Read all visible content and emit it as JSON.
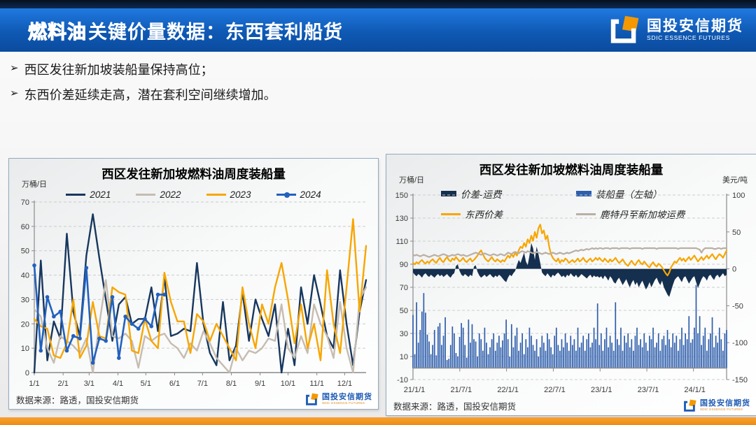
{
  "header": {
    "title_emphasis": "燃料油",
    "title_rest": "关键价量数据：东西套利船货",
    "logo_cn": "国投安信期货",
    "logo_en": "SDIC ESSENCE FUTURES"
  },
  "bullets": [
    "西区发往新加坡装船量保持高位；",
    "东西价差延续走高，潜在套利空间继续增加。"
  ],
  "source_note": "数据来源：路透，国投安信期货",
  "colors": {
    "header_blue": "#0f59b4",
    "accent_orange": "#f39800",
    "bottom_bar_orange": "#ee8c12",
    "navy_2021": "#17375e",
    "gray_2022": "#c6bcb0",
    "orange_2023": "#f7a600",
    "blue_2024": "#2261be",
    "bar_blue": "#2e5eac",
    "area_navy": "#152f4e",
    "freight_gray": "#b9afa4"
  },
  "chart_data": [
    {
      "type": "line",
      "title": "西区发往新加坡燃料油周度装船量",
      "ylabel": "万桶/日",
      "ylim": [
        0,
        70
      ],
      "yticks": [
        0,
        10,
        20,
        30,
        40,
        50,
        60,
        70
      ],
      "grid": "dashed-horizontal",
      "legend_position": "top-inside",
      "xmax": 51,
      "xticks": [
        {
          "p": 0,
          "label": "1/1"
        },
        {
          "p": 4.43,
          "label": "2/1"
        },
        {
          "p": 8.43,
          "label": "3/1"
        },
        {
          "p": 12.86,
          "label": "4/1"
        },
        {
          "p": 17.14,
          "label": "5/1"
        },
        {
          "p": 21.57,
          "label": "6/1"
        },
        {
          "p": 25.86,
          "label": "7/1"
        },
        {
          "p": 30.29,
          "label": "8/1"
        },
        {
          "p": 34.71,
          "label": "9/1"
        },
        {
          "p": 39.0,
          "label": "10/1"
        },
        {
          "p": 43.43,
          "label": "11/1"
        },
        {
          "p": 47.71,
          "label": "12/1"
        }
      ],
      "series": [
        {
          "name": "2021",
          "color": "#17375e",
          "width": 2.4,
          "marker": false,
          "values": [
            0,
            46,
            5,
            21,
            14,
            57,
            25,
            15,
            48,
            65,
            47,
            30,
            13,
            28,
            31,
            20,
            22,
            22,
            35,
            17,
            39,
            15,
            16,
            18,
            17,
            45,
            20,
            8,
            3,
            29,
            5,
            11,
            33,
            13,
            30,
            22,
            15,
            28,
            0,
            18,
            3,
            35,
            20,
            40,
            28,
            15,
            10,
            42,
            20,
            3,
            25,
            38
          ]
        },
        {
          "name": "2022",
          "color": "#c6bcb0",
          "width": 2.4,
          "marker": false,
          "values": [
            26,
            23,
            10,
            4,
            15,
            13,
            11,
            8,
            14,
            0,
            20,
            38,
            15,
            14,
            16,
            13,
            2,
            15,
            13,
            15,
            16,
            12,
            10,
            6,
            12,
            9,
            17,
            12,
            6,
            3,
            0,
            10,
            5,
            9,
            8,
            10,
            14,
            13,
            28,
            10,
            6,
            15,
            8,
            28,
            20,
            15,
            6,
            29,
            10,
            0,
            30,
            35
          ]
        },
        {
          "name": "2023",
          "color": "#f7a600",
          "width": 2.4,
          "marker": false,
          "values": [
            22,
            19,
            18,
            7,
            6,
            12,
            30,
            6,
            11,
            29,
            15,
            14,
            35,
            33,
            32,
            9,
            8,
            22,
            13,
            10,
            41,
            29,
            21,
            21,
            8,
            24,
            21,
            13,
            20,
            15,
            10,
            5,
            35,
            20,
            10,
            28,
            20,
            35,
            45,
            30,
            12,
            28,
            10,
            20,
            5,
            42,
            20,
            8,
            35,
            63,
            25,
            52
          ]
        },
        {
          "name": "2024",
          "color": "#2261be",
          "width": 2.6,
          "marker": true,
          "values": [
            44,
            9,
            31,
            23,
            25,
            9,
            15,
            14,
            43,
            4,
            14,
            13,
            31,
            6,
            23,
            20,
            18,
            22,
            19,
            32,
            32
          ]
        }
      ]
    },
    {
      "type": "combo",
      "title": "西区发往新加坡燃料油周度装船量",
      "ylabel_left": "万桶/日",
      "ylabel_right": "美元/吨",
      "ylim_left": [
        -10,
        150
      ],
      "yticks_left": [
        -10,
        10,
        30,
        50,
        70,
        90,
        110,
        130,
        150
      ],
      "ylim_right": [
        -150,
        100
      ],
      "yticks_right": [
        -150,
        -100,
        -50,
        0,
        50,
        100
      ],
      "grid": "dashed-horizontal",
      "xmax": 175,
      "xticks": [
        {
          "p": 0,
          "label": "21/1/1"
        },
        {
          "p": 26.1,
          "label": "21/7/1"
        },
        {
          "p": 52.2,
          "label": "22/1/1"
        },
        {
          "p": 78.3,
          "label": "22/7/1"
        },
        {
          "p": 104.4,
          "label": "23/1/1"
        },
        {
          "p": 130.5,
          "label": "23/7/1"
        },
        {
          "p": 156.5,
          "label": "24/1/1"
        }
      ],
      "series": [
        {
          "name": "价差-运费",
          "kind": "area",
          "axis": "right",
          "color": "#152f4e",
          "values": [
            -5,
            -8,
            -10,
            -7,
            -9,
            -12,
            -8,
            -6,
            -9,
            -11,
            -8,
            -10,
            -12,
            -9,
            -7,
            -10,
            -8,
            -11,
            -9,
            -7,
            -10,
            -12,
            -8,
            -6,
            4,
            6,
            -3,
            -8,
            -10,
            -7,
            -9,
            -11,
            -8,
            -10,
            3,
            5,
            -4,
            -9,
            -12,
            -10,
            -8,
            -11,
            -9,
            -7,
            -10,
            -12,
            -9,
            -11,
            -8,
            -10,
            -13,
            -16,
            -18,
            -12,
            -8,
            -10,
            -6,
            -3,
            5,
            12,
            8,
            15,
            22,
            10,
            5,
            18,
            35,
            28,
            12,
            30,
            20,
            8,
            -5,
            -8,
            -10,
            -6,
            -9,
            -12,
            -8,
            -10,
            -7,
            -5,
            -8,
            -11,
            -9,
            -12,
            -8,
            -10,
            -6,
            -9,
            -11,
            -8,
            -12,
            -10,
            -7,
            -9,
            -11,
            -13,
            -10,
            -8,
            -12,
            -9,
            -11,
            -10,
            -12,
            -10,
            -14,
            -9,
            -12,
            -16,
            -10,
            -13,
            -18,
            -20,
            -15,
            -12,
            -17,
            -22,
            -18,
            -14,
            -20,
            -25,
            -19,
            -15,
            -22,
            -18,
            -25,
            -20,
            -16,
            -22,
            -28,
            -24,
            -18,
            -25,
            -20,
            -15,
            -12,
            -18,
            -22,
            -16,
            -25,
            -30,
            -35,
            -38,
            -30,
            -22,
            -15,
            -12,
            -10,
            -14,
            -18,
            -12,
            -10,
            -15,
            -20,
            -16,
            -12,
            -10,
            -18,
            -26,
            -20,
            -14,
            -10,
            -12,
            -16,
            -10,
            -8,
            -12,
            -15,
            -10,
            -8,
            -12,
            -9,
            -6,
            -10,
            -8
          ]
        },
        {
          "name": "装船量（左轴）",
          "kind": "bar",
          "axis": "left",
          "color": "#2e5eac",
          "values": [
            46,
            12,
            57,
            22,
            33,
            49,
            65,
            48,
            29,
            23,
            12,
            20,
            33,
            11,
            36,
            39,
            20,
            28,
            44,
            7,
            8,
            20,
            36,
            30,
            13,
            10,
            27,
            39,
            35,
            20,
            9,
            42,
            22,
            38,
            25,
            23,
            10,
            30,
            25,
            15,
            35,
            22,
            12,
            18,
            25,
            30,
            15,
            22,
            28,
            18,
            24,
            30,
            42,
            25,
            10,
            38,
            18,
            28,
            35,
            15,
            22,
            30,
            12,
            25,
            18,
            35,
            28,
            20,
            15,
            25,
            10,
            18,
            28,
            22,
            15,
            30,
            25,
            18,
            12,
            28,
            35,
            20,
            15,
            25,
            18,
            30,
            22,
            15,
            28,
            20,
            25,
            15,
            35,
            18,
            22,
            28,
            15,
            25,
            30,
            18,
            22,
            35,
            25,
            56,
            20,
            30,
            15,
            25,
            35,
            18,
            28,
            22,
            15,
            57,
            25,
            20,
            35,
            15,
            28,
            22,
            30,
            18,
            25,
            15,
            28,
            35,
            20,
            25,
            18,
            30,
            22,
            15,
            28,
            25,
            35,
            18,
            22,
            30,
            15,
            25,
            28,
            20,
            33,
            25,
            18,
            30,
            22,
            28,
            15,
            25,
            35,
            20,
            30,
            25,
            45,
            22,
            25,
            35,
            72,
            30,
            45,
            20,
            28,
            35,
            15,
            25,
            30,
            44,
            18,
            28,
            22,
            35,
            25,
            15,
            30,
            33
          ]
        },
        {
          "name": "东西价差",
          "kind": "line",
          "axis": "right",
          "color": "#f7a600",
          "width": 2.2,
          "values": [
            8,
            6,
            9,
            7,
            10,
            12,
            9,
            7,
            10,
            8,
            11,
            13,
            10,
            8,
            12,
            15,
            11,
            9,
            13,
            16,
            12,
            10,
            14,
            12,
            16,
            13,
            10,
            12,
            15,
            11,
            9,
            12,
            14,
            10,
            12,
            15,
            18,
            22,
            25,
            20,
            15,
            12,
            10,
            13,
            16,
            12,
            10,
            13,
            11,
            9,
            12,
            10,
            14,
            18,
            15,
            20,
            16,
            22,
            18,
            25,
            30,
            28,
            35,
            30,
            40,
            35,
            45,
            38,
            50,
            42,
            55,
            60,
            48,
            52,
            40,
            45,
            30,
            20,
            15,
            12,
            10,
            14,
            8,
            12,
            10,
            14,
            12,
            8,
            10,
            12,
            9,
            11,
            14,
            10,
            12,
            15,
            11,
            9,
            12,
            14,
            10,
            12,
            15,
            12,
            15,
            12,
            10,
            14,
            11,
            9,
            13,
            10,
            12,
            15,
            11,
            8,
            10,
            13,
            9,
            6,
            4,
            8,
            11,
            7,
            5,
            9,
            12,
            8,
            6,
            10,
            7,
            4,
            2,
            6,
            9,
            5,
            3,
            7,
            5,
            2,
            -2,
            -6,
            -9,
            -5,
            2,
            6,
            10,
            8,
            12,
            15,
            11,
            14,
            10,
            13,
            16,
            12,
            15,
            18,
            14,
            10,
            13,
            16,
            12,
            15,
            18,
            14,
            17,
            20,
            16,
            13,
            17,
            20,
            18,
            15,
            20,
            25
          ]
        },
        {
          "name": "鹿特丹至新加坡运费",
          "kind": "line",
          "axis": "right",
          "color": "#b9afa4",
          "width": 2.2,
          "values": [
            19,
            18,
            19,
            18,
            17,
            18,
            19,
            18,
            17,
            16,
            17,
            18,
            19,
            18,
            17,
            18,
            19,
            20,
            19,
            18,
            17,
            18,
            19,
            18,
            19,
            20,
            19,
            18,
            19,
            18,
            17,
            18,
            19,
            20,
            21,
            22,
            21,
            20,
            19,
            20,
            21,
            20,
            19,
            18,
            19,
            20,
            19,
            18,
            19,
            20,
            19,
            18,
            20,
            22,
            21,
            20,
            22,
            23,
            22,
            21,
            23,
            24,
            23,
            22,
            24,
            23,
            22,
            21,
            22,
            23,
            22,
            21,
            20,
            21,
            22,
            21,
            20,
            21,
            22,
            21,
            20,
            21,
            22,
            21,
            20,
            21,
            22,
            21,
            22,
            23,
            24,
            25,
            24,
            25,
            26,
            25,
            26,
            27,
            26,
            27,
            28,
            27,
            28,
            27,
            28,
            28,
            27,
            28,
            28,
            28,
            27,
            28,
            28,
            28,
            28,
            27,
            28,
            28,
            28,
            28,
            28,
            27,
            28,
            28,
            28,
            28,
            28,
            28,
            27,
            28,
            28,
            28,
            28,
            28,
            28,
            28,
            27,
            28,
            28,
            28,
            28,
            28,
            28,
            28,
            28,
            28,
            28,
            28,
            27,
            28,
            28,
            28,
            28,
            28,
            28,
            28,
            28,
            28,
            28,
            27,
            26,
            22,
            26,
            28,
            28,
            28,
            28,
            28,
            27,
            27,
            28,
            28,
            27,
            28,
            28,
            28
          ]
        }
      ]
    }
  ]
}
